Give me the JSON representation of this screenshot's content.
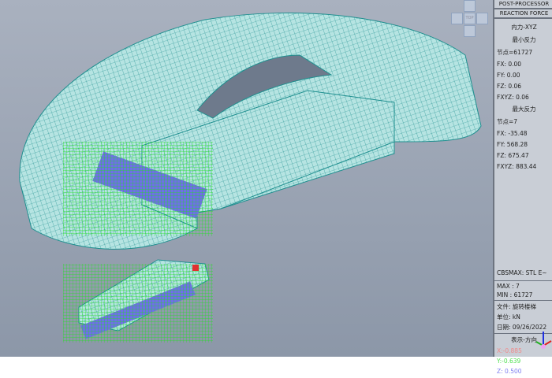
{
  "panel": {
    "title": "POST-PROCESSOR",
    "mode": "REACTION FORCE",
    "component": "内力-XYZ",
    "min_heading": "最小反力",
    "min_node": "节点=61727",
    "min_fx": "FX:   0.00",
    "min_fy": "FY:   0.00",
    "min_fz": "FZ:   0.06",
    "min_fxyz": "FXYZ: 0.06",
    "max_heading": "最大反力",
    "max_node": "节点=7",
    "max_fx": "FX:   -35.48",
    "max_fy": "FY:    568.28",
    "max_fz": "FZ:   675.47",
    "max_fxyz": "FXYZ: 883.44",
    "cbsmax": "CBSMAX: STL E~",
    "max": "MAX : 7",
    "min": "MIN : 61727",
    "file": "文件: 旋转楼梯",
    "unit": "单位: kN",
    "date": "日期: 09/26/2022",
    "direction": "表示-方向",
    "x": "X:-0.885",
    "y": "Y:-0.639",
    "z": "Z: 0.500"
  },
  "nav": {
    "top_label": "TOP"
  },
  "colors": {
    "mesh_fill": "#b6e4e2",
    "mesh_line": "#1f8f8f",
    "support": "#6f6fe8",
    "reaction": "#22e022"
  }
}
